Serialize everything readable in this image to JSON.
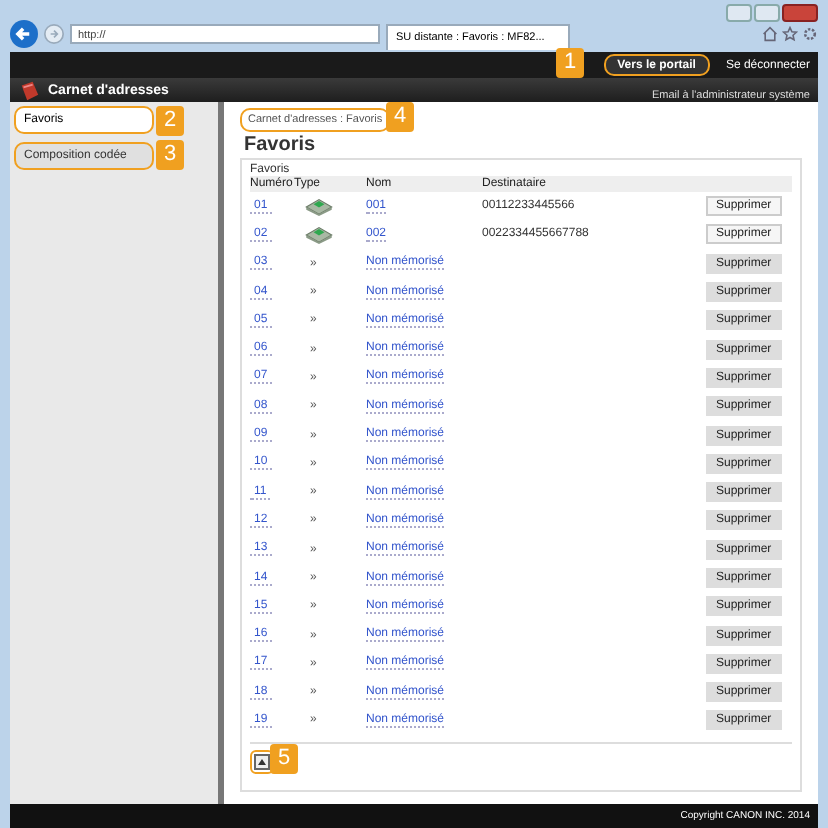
{
  "browser": {
    "address": "http://",
    "tab_title": "SU distante : Favoris : MF82..."
  },
  "header": {
    "portal_button": "Vers le portail",
    "logout_link": "Se déconnecter",
    "title": "Carnet d'adresses",
    "admin_link": "Email à l'administrateur système"
  },
  "sidebar": {
    "items": [
      {
        "label": "Favoris",
        "selected": true
      },
      {
        "label": "Composition codée",
        "selected": false
      }
    ]
  },
  "breadcrumb": "Carnet d'adresses : Favoris",
  "page_title": "Favoris",
  "table": {
    "caption": "Favoris",
    "columns": [
      "Numéro",
      "Type",
      "Nom",
      "Destinataire"
    ],
    "rows": [
      {
        "number": "01",
        "kind": "fax",
        "type": "",
        "name": "001",
        "destination": "00112233445566",
        "action": "Supprimer"
      },
      {
        "number": "02",
        "kind": "fax",
        "type": "",
        "name": "002",
        "destination": "0022334455667788",
        "action": "Supprimer"
      },
      {
        "number": "03",
        "kind": "empty",
        "type": "»",
        "name": "Non mémorisé",
        "destination": "",
        "action": "Supprimer"
      },
      {
        "number": "04",
        "kind": "empty",
        "type": "»",
        "name": "Non mémorisé",
        "destination": "",
        "action": "Supprimer"
      },
      {
        "number": "05",
        "kind": "empty",
        "type": "»",
        "name": "Non mémorisé",
        "destination": "",
        "action": "Supprimer"
      },
      {
        "number": "06",
        "kind": "empty",
        "type": "»",
        "name": "Non mémorisé",
        "destination": "",
        "action": "Supprimer"
      },
      {
        "number": "07",
        "kind": "empty",
        "type": "»",
        "name": "Non mémorisé",
        "destination": "",
        "action": "Supprimer"
      },
      {
        "number": "08",
        "kind": "empty",
        "type": "»",
        "name": "Non mémorisé",
        "destination": "",
        "action": "Supprimer"
      },
      {
        "number": "09",
        "kind": "empty",
        "type": "»",
        "name": "Non mémorisé",
        "destination": "",
        "action": "Supprimer"
      },
      {
        "number": "10",
        "kind": "empty",
        "type": "»",
        "name": "Non mémorisé",
        "destination": "",
        "action": "Supprimer"
      },
      {
        "number": "11",
        "kind": "empty",
        "type": "»",
        "name": "Non mémorisé",
        "destination": "",
        "action": "Supprimer"
      },
      {
        "number": "12",
        "kind": "empty",
        "type": "»",
        "name": "Non mémorisé",
        "destination": "",
        "action": "Supprimer"
      },
      {
        "number": "13",
        "kind": "empty",
        "type": "»",
        "name": "Non mémorisé",
        "destination": "",
        "action": "Supprimer"
      },
      {
        "number": "14",
        "kind": "empty",
        "type": "»",
        "name": "Non mémorisé",
        "destination": "",
        "action": "Supprimer"
      },
      {
        "number": "15",
        "kind": "empty",
        "type": "»",
        "name": "Non mémorisé",
        "destination": "",
        "action": "Supprimer"
      },
      {
        "number": "16",
        "kind": "empty",
        "type": "»",
        "name": "Non mémorisé",
        "destination": "",
        "action": "Supprimer"
      },
      {
        "number": "17",
        "kind": "empty",
        "type": "»",
        "name": "Non mémorisé",
        "destination": "",
        "action": "Supprimer"
      },
      {
        "number": "18",
        "kind": "empty",
        "type": "»",
        "name": "Non mémorisé",
        "destination": "",
        "action": "Supprimer"
      },
      {
        "number": "19",
        "kind": "empty",
        "type": "»",
        "name": "Non mémorisé",
        "destination": "",
        "action": "Supprimer"
      }
    ]
  },
  "callouts": [
    "1",
    "2",
    "3",
    "4",
    "5"
  ],
  "footer": "Copyright CANON INC. 2014"
}
